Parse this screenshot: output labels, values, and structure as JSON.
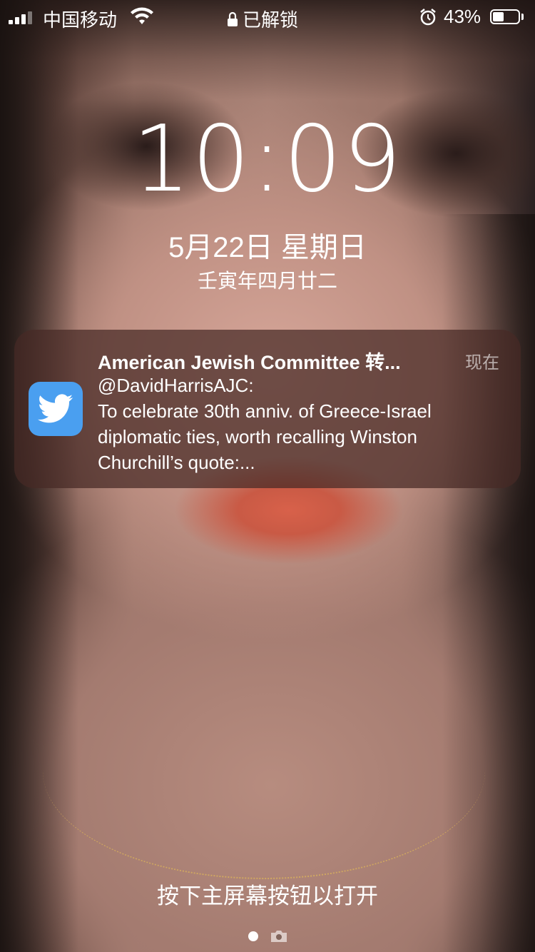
{
  "status_bar": {
    "carrier": "中国移动",
    "lock_status": "已解锁",
    "battery_percent": "43%",
    "battery_level": 0.43,
    "icons": [
      "signal-icon",
      "wifi-icon",
      "lock-icon",
      "alarm-icon",
      "battery-icon"
    ]
  },
  "lockscreen": {
    "time": "10:09",
    "date": "5月22日 星期日",
    "lunar_date": "壬寅年四月廿二"
  },
  "notification": {
    "app_icon": "twitter-icon",
    "title": "American Jewish Committee 转...",
    "time": "现在",
    "body_lines": [
      "@DavidHarrisAJC:",
      "To celebrate 30th anniv. of Greece-Israel",
      "diplomatic ties, worth recalling Winston",
      "Churchill’s quote:..."
    ],
    "accent_color": "#4a9ff0"
  },
  "footer": {
    "unlock_hint": "按下主屏幕按钮以打开",
    "page_indicators": [
      "page-dot",
      "camera-icon"
    ]
  }
}
